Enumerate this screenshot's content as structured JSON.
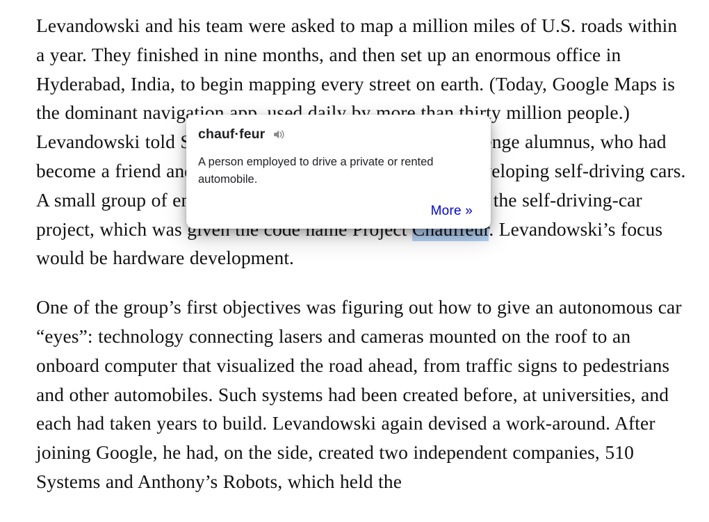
{
  "article": {
    "paragraphs": [
      {
        "id": "paragraph-1",
        "segments": [
          {
            "type": "text",
            "text": "Levandowski and his team were asked to map a million miles of U.S. roads within a year. They finished in nine months, and then set up an enormous office in Hyderabad, India, to begin mapping every street on earth. (Today, Google Maps is the dominant navigation app, used daily by more than thirty million people.) Levandowski told Sebastian Thrun—another Grand Challenge alumnus, who had become a friend and mentorship that the next step was developing self-driving cars. A small group of engineers, led by Thrun, was assigned to the self-driving-car project, which was given the code name Project "
          },
          {
            "type": "selection",
            "text": "Chauffeur"
          },
          {
            "type": "text",
            "text": ". Levandowski’s focus would be hardware development."
          }
        ]
      },
      {
        "id": "paragraph-2",
        "segments": [
          {
            "type": "text",
            "text": "One of the group’s first objectives was figuring out how to give an autonomous car “eyes”: technology connecting lasers and cameras mounted on the roof to an onboard computer that visualized the road ahead, from traffic signs to pedestrians and other automobiles. Such systems had been created before, at universities, and each had taken years to build. Levandowski again devised a work-around. After joining Google, he had, on the side, created two independent companies, 510 Systems and Anthony’s Robots, which held the"
          }
        ]
      }
    ]
  },
  "dictionary_popup": {
    "headword": "chauf·feur",
    "pronounce_icon": "speaker-icon",
    "definition": "A person employed to drive a private or rented automobile.",
    "more_label": "More »",
    "link_color": "#0000ee",
    "selection_color": "#b6d4f7",
    "background": "#ffffff"
  }
}
